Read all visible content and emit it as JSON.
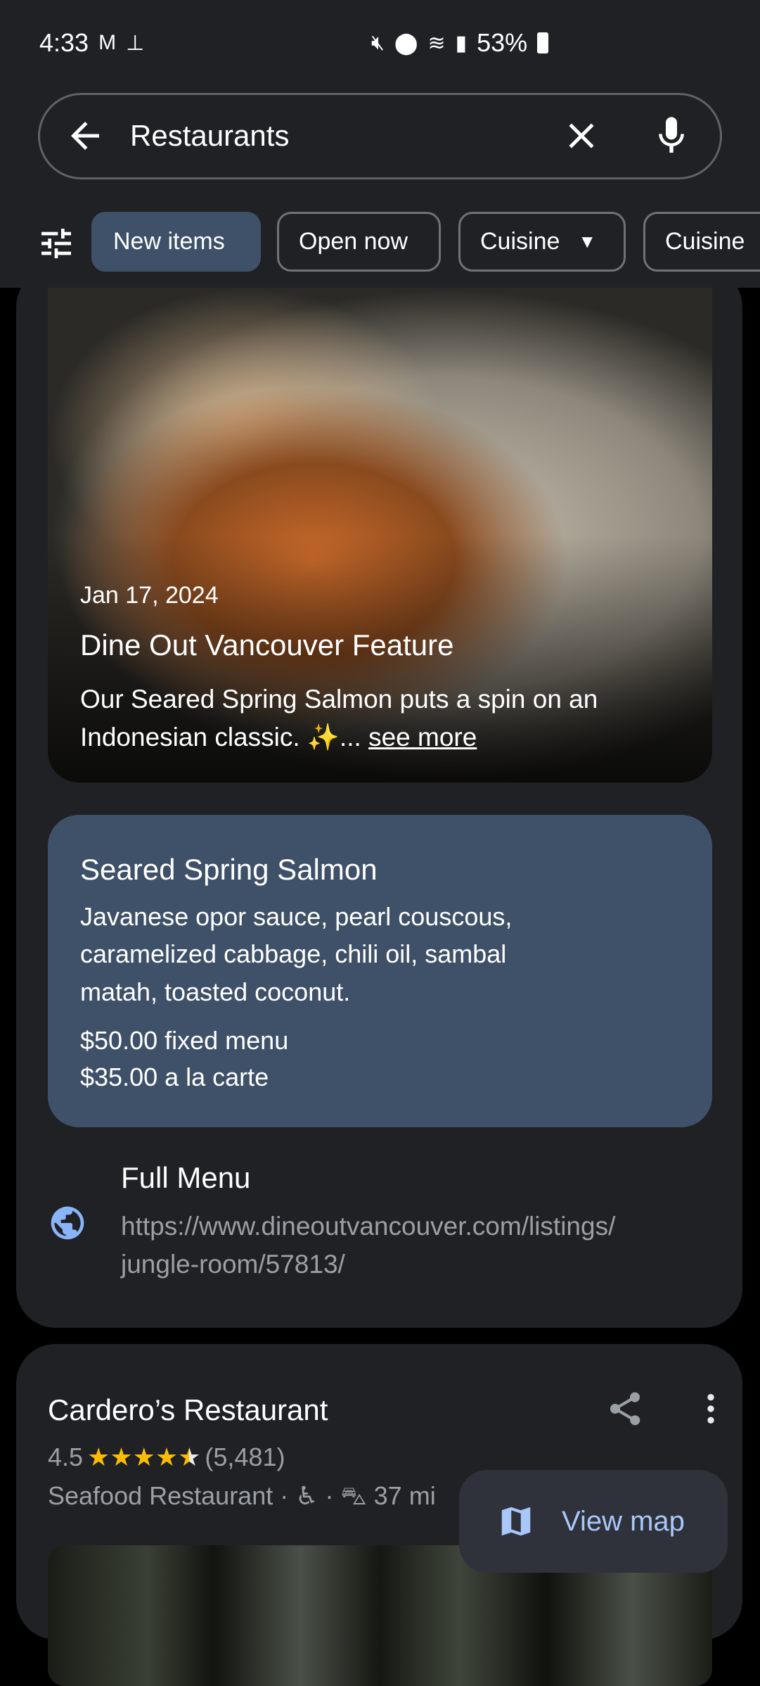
{
  "status_bar": {
    "time": "4:33",
    "battery": "53%",
    "icons": [
      "gmail-icon",
      "pin-icon",
      "mute-icon",
      "location-icon",
      "wifi-icon",
      "signal-icon",
      "battery-icon"
    ]
  },
  "search": {
    "query": "Restaurants"
  },
  "filters": {
    "chips": [
      "New items",
      "Open now",
      "Cuisine",
      "Cuisine"
    ]
  },
  "post": {
    "date": "Jan 17, 2024",
    "title": "Dine Out Vancouver Feature",
    "description": "Our Seared Spring Salmon puts a spin on an Indonesian classic. ✨...",
    "see_more": "see more"
  },
  "menu_item": {
    "name": "Seared Spring Salmon",
    "description": [
      "Javanese opor sauce, pearl couscous,",
      "caramelized cabbage, chili oil, sambal",
      "matah, toasted coconut."
    ],
    "prices": [
      "$50.00 fixed menu",
      "$35.00 a la carte"
    ]
  },
  "full_menu": {
    "label": "Full Menu",
    "url_lines": [
      "https://www.dineoutvancouver.com/listings/",
      "jungle-room/57813/"
    ]
  },
  "result2": {
    "name": "Cardero’s Restaurant",
    "rating": "4.5",
    "rating_value": 4.5,
    "reviews": "(5,481)",
    "category": "Seafood Restaurant",
    "distance": "37 mi"
  },
  "view_map": {
    "label": "View map"
  },
  "colors": {
    "accent": "#a8c7fa",
    "chip_selected": "#3f5169",
    "star": "#fbbc04",
    "background": "#202124"
  }
}
